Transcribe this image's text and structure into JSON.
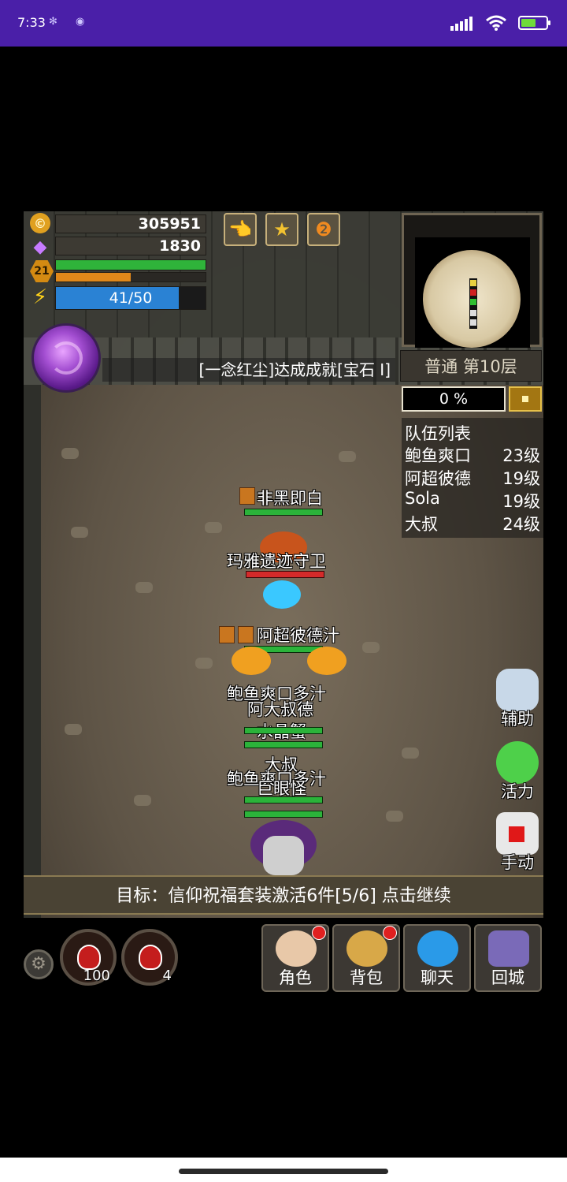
{
  "status_bar": {
    "time": "7:33",
    "battery_level": 0.6,
    "bg_color": "#4a1fa8"
  },
  "resources": {
    "gold": "305951",
    "gems": "1830",
    "level": "21",
    "energy": "41/50",
    "hp_fraction": 1.0,
    "exp_fraction": 0.5,
    "energy_fraction": 0.82
  },
  "top_buttons": [
    {
      "icon": "hand-icon"
    },
    {
      "icon": "star-medal-icon"
    },
    {
      "icon": "rank-2-medal-icon"
    }
  ],
  "minimap": {
    "floor_label": "普通 第10层"
  },
  "achievement_message": "[一念红尘]达成成就[宝石 I]",
  "progress": {
    "percent": "0 %",
    "value": 0
  },
  "team": {
    "title": "队伍列表",
    "members": [
      {
        "name": "鲍鱼爽口",
        "level": "23级"
      },
      {
        "name": "阿超彼德",
        "level": "19级"
      },
      {
        "name": "Sola",
        "level": "19级"
      },
      {
        "name": "大叔",
        "level": "24级"
      }
    ]
  },
  "units": {
    "feiheijibai": "非黑即白",
    "guardian": "玛雅遗迹守卫",
    "achao": "阿超彼德汁",
    "baoyu_overlap_1": "鲍鱼爽口多汁",
    "dashu_overlap": "阿大叔德",
    "crystal_crab": "水晶蟹",
    "dashu": "大叔",
    "baoyu_overlap_2": "鲍鱼爽口多汁",
    "giant_eye": "巨眼怪"
  },
  "side_buttons": {
    "assist": "辅助",
    "vitality": "活力",
    "manual": "手动"
  },
  "quest": "目标：信仰祝福套装激活6件[5/6]  点击继续",
  "potions": {
    "hp_count": "100",
    "mp_count": "4"
  },
  "menu": {
    "character": "角色",
    "bag": "背包",
    "chat": "聊天",
    "return_city": "回城"
  }
}
